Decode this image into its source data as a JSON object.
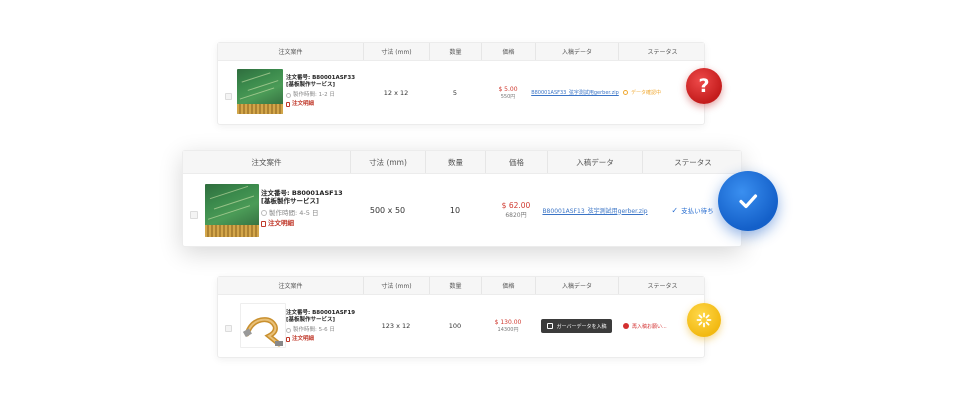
{
  "headers": {
    "order": "注文案件",
    "size": "寸法 (mm)",
    "qty": "数量",
    "price": "価格",
    "input_data": "入稿データ",
    "status": "ステータス"
  },
  "rows": [
    {
      "order_number": "注文番号: B80001ASF33",
      "service": "[基板製作サービス]",
      "lead_time": "製作時間: 1-2 日",
      "detail_link": "注文明細",
      "size": "12 x 12",
      "qty": "5",
      "price_usd": "$ 5.00",
      "price_jpy": "550円",
      "file": "B80001ASF33_弦宇測試用gerber.zip",
      "status": "データ確認中",
      "status_color": "#f0a830",
      "badge": "?",
      "badge_icon": "question-icon",
      "badge_color": "#d32f2f"
    },
    {
      "order_number": "注文番号: B80001ASF13",
      "service": "[基板製作サービス]",
      "lead_time": "製作時間: 4-5 日",
      "detail_link": "注文明細",
      "size": "500 x 50",
      "qty": "10",
      "price_usd": "$ 62.00",
      "price_jpy": "6820円",
      "file": "B80001ASF13_弦宇測試用gerber.zip",
      "status": "支払い待ち",
      "status_color": "#2a6fd1",
      "badge_icon": "checkmark-icon",
      "badge_color": "#1a6fdc"
    },
    {
      "order_number": "注文番号: B80001ASF19",
      "service": "[基板製作サービス]",
      "lead_time": "製作時間: 5-6 日",
      "detail_link": "注文明細",
      "size": "123 x 12",
      "qty": "100",
      "price_usd": "$ 130.00",
      "price_jpy": "14300円",
      "upload_button": "ガーバーデータを入稿",
      "status": "再入稿お願い...",
      "status_color": "#d32f2f",
      "badge_icon": "loading-spinner-icon",
      "badge_color": "#f5c21b"
    }
  ]
}
